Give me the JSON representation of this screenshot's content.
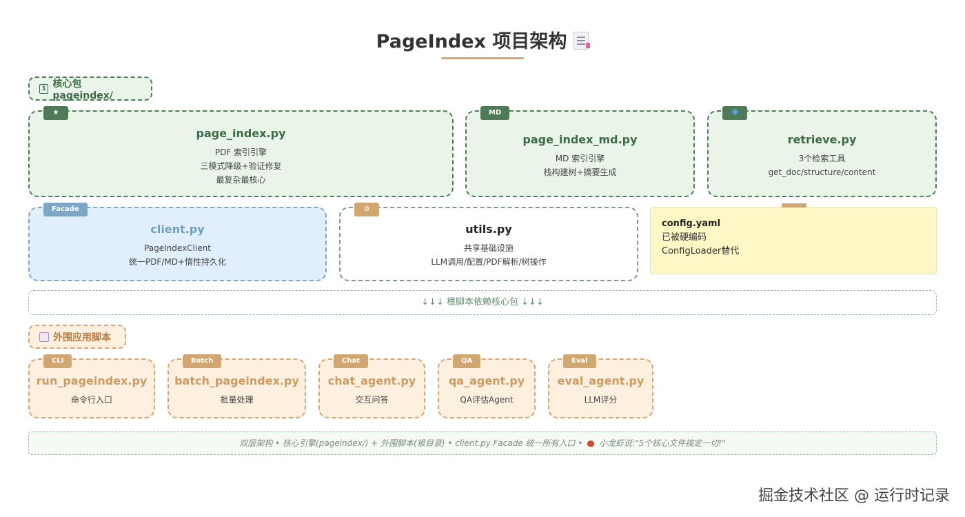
{
  "title": "PageIndex 项目架构",
  "core_section": {
    "icon": "1",
    "label": "核心包 pageindex/"
  },
  "core_cards": {
    "page_index": {
      "tag": "★",
      "title": "page_index.py",
      "lines": [
        "PDF 索引引擎",
        "三模式降级+验证修复",
        "最复杂最核心"
      ]
    },
    "page_index_md": {
      "tag": "MD",
      "title": "page_index_md.py",
      "lines": [
        "MD 索引引擎",
        "栈构建树+摘要生成"
      ]
    },
    "retrieve": {
      "tag": "🔹",
      "title": "retrieve.py",
      "lines": [
        "3个检索工具",
        "get_doc/structure/content"
      ]
    },
    "client": {
      "tag": "Facade",
      "title": "client.py",
      "lines": [
        "PageIndexClient",
        "统一PDF/MD+惰性持久化"
      ]
    },
    "utils": {
      "tag": "⚙",
      "title": "utils.py",
      "lines": [
        "共享基础设施",
        "LLM调用/配置/PDF解析/树操作"
      ]
    }
  },
  "config_note": {
    "title": "config.yaml",
    "lines": [
      "已被硬编码",
      "ConfigLoader替代"
    ]
  },
  "dependency_text": "↓↓↓ 根脚本依赖核心包 ↓↓↓",
  "ext_section": {
    "label": "外围应用脚本"
  },
  "ext_cards": [
    {
      "tag": "CLI",
      "title": "run_pageindex.py",
      "desc": "命令行入口"
    },
    {
      "tag": "Batch",
      "title": "batch_pageindex.py",
      "desc": "批量处理"
    },
    {
      "tag": "Chat",
      "title": "chat_agent.py",
      "desc": "交互问答"
    },
    {
      "tag": "QA",
      "title": "qa_agent.py",
      "desc": "QA评估Agent"
    },
    {
      "tag": "Eval",
      "title": "eval_agent.py",
      "desc": "LLM评分"
    }
  ],
  "footer": {
    "text_before": "双层架构 • 核心引擎(pageindex/) + 外围脚本(根目录) • client.py Facade 统一所有入口 •",
    "text_after": "小龙虾说:\"5个核心文件搞定一切!\""
  },
  "watermark": "掘金技术社区 @ 运行时记录",
  "colors": {
    "core_green": "#4f7a57",
    "facade_blue": "#7ea7c6",
    "script_orange": "#d2a671",
    "note_yellow": "#fff8c6"
  }
}
